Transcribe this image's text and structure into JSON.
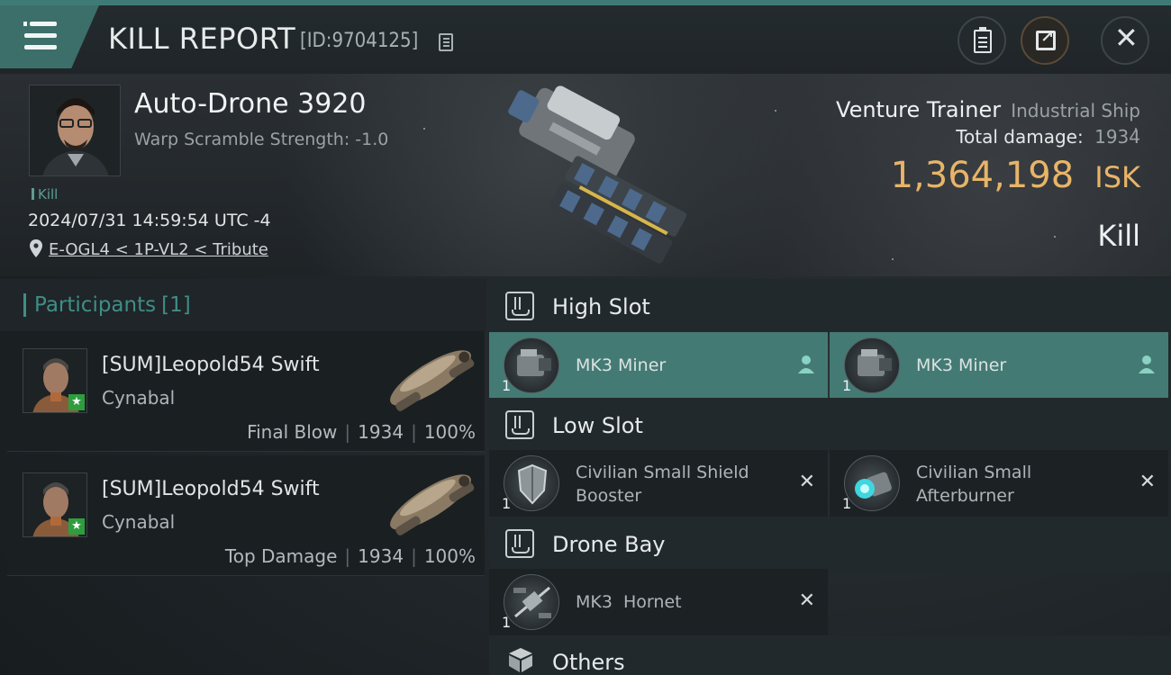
{
  "header": {
    "title": "KILL REPORT",
    "report_id": "[ID:9704125]"
  },
  "victim": {
    "name": "Auto-Drone 3920",
    "warp_scramble": "Warp Scramble Strength: -1.0",
    "tag": "Kill",
    "datetime": "2024/07/31 14:59:54 UTC -4",
    "location": "E-OGL4 < 1P-VL2 < Tribute",
    "ship_name": "Venture Trainer",
    "ship_class": "Industrial Ship",
    "total_damage_label": "Total damage:",
    "total_damage": "1934",
    "isk_value": "1,364,198",
    "isk_unit": "ISK",
    "kill_type": "Kill"
  },
  "participants": {
    "title": "Participants",
    "count": "[1]",
    "items": [
      {
        "name": "[SUM]Leopold54 Swift",
        "ship": "Cynabal",
        "role": "Final Blow",
        "damage": "1934",
        "percent": "100%"
      },
      {
        "name": "[SUM]Leopold54 Swift",
        "ship": "Cynabal",
        "role": "Top Damage",
        "damage": "1934",
        "percent": "100%"
      }
    ]
  },
  "fitting": {
    "high_slot": {
      "label": "High Slot",
      "items": [
        {
          "name": "MK3 Miner",
          "qty": "1"
        },
        {
          "name": "MK3 Miner",
          "qty": "1"
        }
      ]
    },
    "low_slot": {
      "label": "Low Slot",
      "items": [
        {
          "name_line1": "Civilian Small Shield",
          "name_line2": "Booster",
          "qty": "1",
          "status": "✕"
        },
        {
          "name_line1": "Civilian Small",
          "name_line2": "Afterburner",
          "qty": "1",
          "status": "✕"
        }
      ]
    },
    "drone_bay": {
      "label": "Drone Bay",
      "items": [
        {
          "name": "MK3  Hornet",
          "qty": "1",
          "status": "✕"
        }
      ]
    },
    "others": {
      "label": "Others"
    }
  },
  "colors": {
    "accent": "#3f8e86",
    "highlight": "#447a74",
    "isk": "#e8b468"
  }
}
